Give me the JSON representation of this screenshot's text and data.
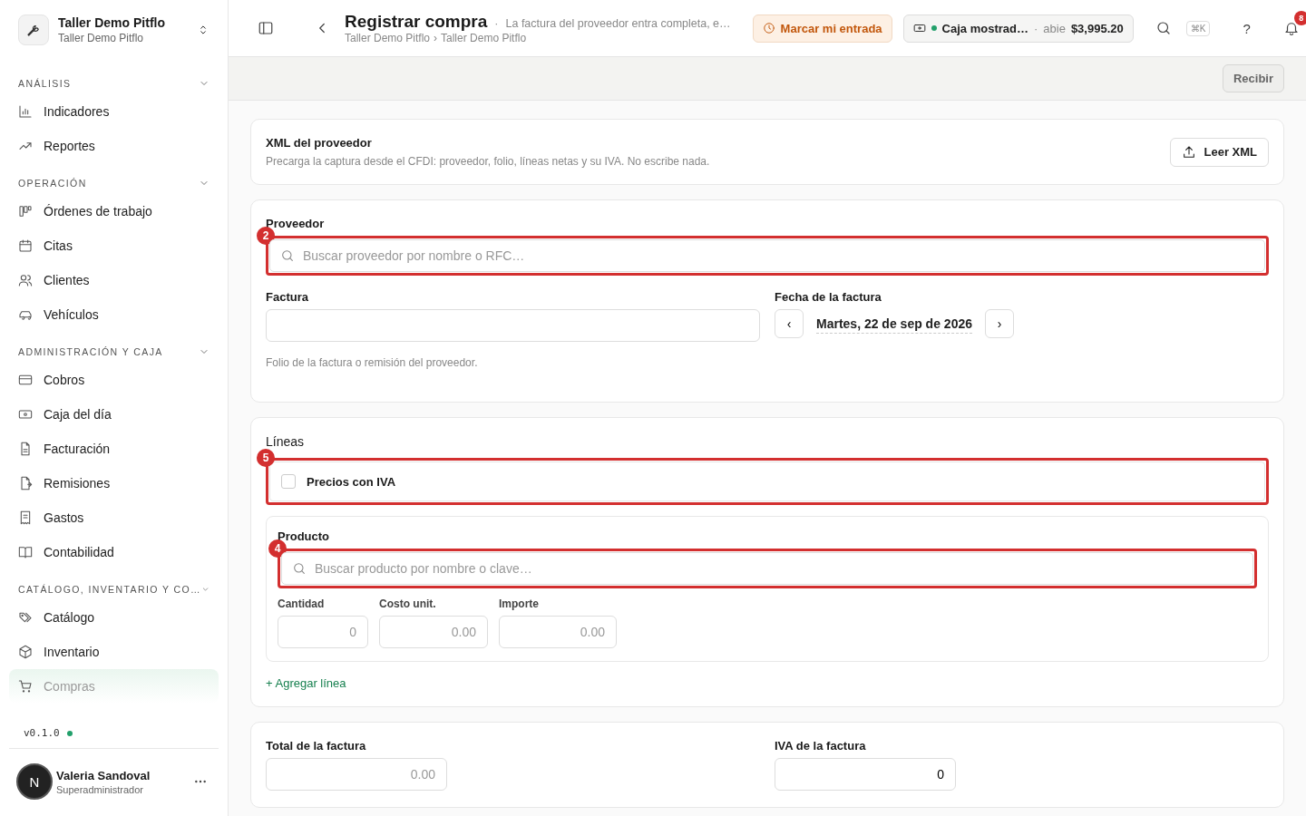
{
  "workspace": {
    "name": "Taller Demo Pitflo",
    "subtitle": "Taller Demo Pitflo"
  },
  "sidebar": {
    "sections": [
      {
        "title": "ANÁLISIS",
        "expanded": true,
        "items": [
          {
            "label": "Indicadores",
            "selected": false
          },
          {
            "label": "Reportes",
            "selected": false
          }
        ]
      },
      {
        "title": "OPERACIÓN",
        "expanded": true,
        "items": [
          {
            "label": "Órdenes de trabajo",
            "selected": false
          },
          {
            "label": "Citas",
            "selected": false
          },
          {
            "label": "Clientes",
            "selected": false
          },
          {
            "label": "Vehículos",
            "selected": false
          }
        ]
      },
      {
        "title": "ADMINISTRACIÓN Y CAJA",
        "expanded": true,
        "items": [
          {
            "label": "Cobros",
            "selected": false
          },
          {
            "label": "Caja del día",
            "selected": false
          },
          {
            "label": "Facturación",
            "selected": false
          },
          {
            "label": "Remisiones",
            "selected": false
          },
          {
            "label": "Gastos",
            "selected": false
          },
          {
            "label": "Contabilidad",
            "selected": false
          }
        ]
      },
      {
        "title": "CATÁLOGO, INVENTARIO Y CO…",
        "expanded": true,
        "items": [
          {
            "label": "Catálogo",
            "selected": false
          },
          {
            "label": "Inventario",
            "selected": false
          },
          {
            "label": "Compras",
            "selected": true
          }
        ]
      }
    ],
    "version": "v0.1.0",
    "user": {
      "initial": "N",
      "name": "Valeria Sandoval",
      "role": "Superadministrador"
    }
  },
  "header": {
    "title": "Registrar compra",
    "separator": "·",
    "description": "La factura del proveedor entra completa, e…",
    "breadcrumb": [
      "Taller Demo Pitflo",
      "Taller Demo Pitflo"
    ],
    "breadcrumb_separator": "›",
    "clock_button": "Marcar mi entrada",
    "register": {
      "name": "Caja mostrad…",
      "separator": "·",
      "status": "abie",
      "amount": "$3,995.20"
    },
    "shortcut": "⌘K",
    "help": "?",
    "notifications": "8"
  },
  "actions": [
    "Recibir"
  ],
  "xml_card": {
    "title": "XML del proveedor",
    "description": "Precarga la captura desde el CFDI: proveedor, folio, líneas netas y su IVA. No escribe nada.",
    "button": "Leer XML"
  },
  "supplier_card": {
    "supplier": {
      "label": "Proveedor",
      "placeholder": "Buscar proveedor por nombre o RFC…",
      "annotation": "2"
    },
    "invoice": {
      "label": "Factura",
      "hint": "Folio de la factura o remisión del proveedor."
    },
    "date": {
      "label": "Fecha de la factura",
      "prev": "‹",
      "value": "Martes, 22 de sep de 2026",
      "next": "›"
    }
  },
  "lines_card": {
    "title": "Líneas",
    "prices_with_vat": {
      "label": "Precios con IVA",
      "checked": false,
      "annotation": "5"
    },
    "product": {
      "label": "Producto",
      "placeholder": "Buscar producto por nombre o clave…",
      "annotation": "4"
    },
    "fields": [
      {
        "label": "Cantidad",
        "placeholder": "0"
      },
      {
        "label": "Costo unit.",
        "placeholder": "0.00"
      },
      {
        "label": "Importe",
        "placeholder": "0.00"
      }
    ],
    "add_line": "+ Agregar línea"
  },
  "totals_card": {
    "total": {
      "label": "Total de la factura",
      "placeholder": "0.00"
    },
    "vat": {
      "label": "IVA de la factura",
      "value": "0"
    }
  }
}
